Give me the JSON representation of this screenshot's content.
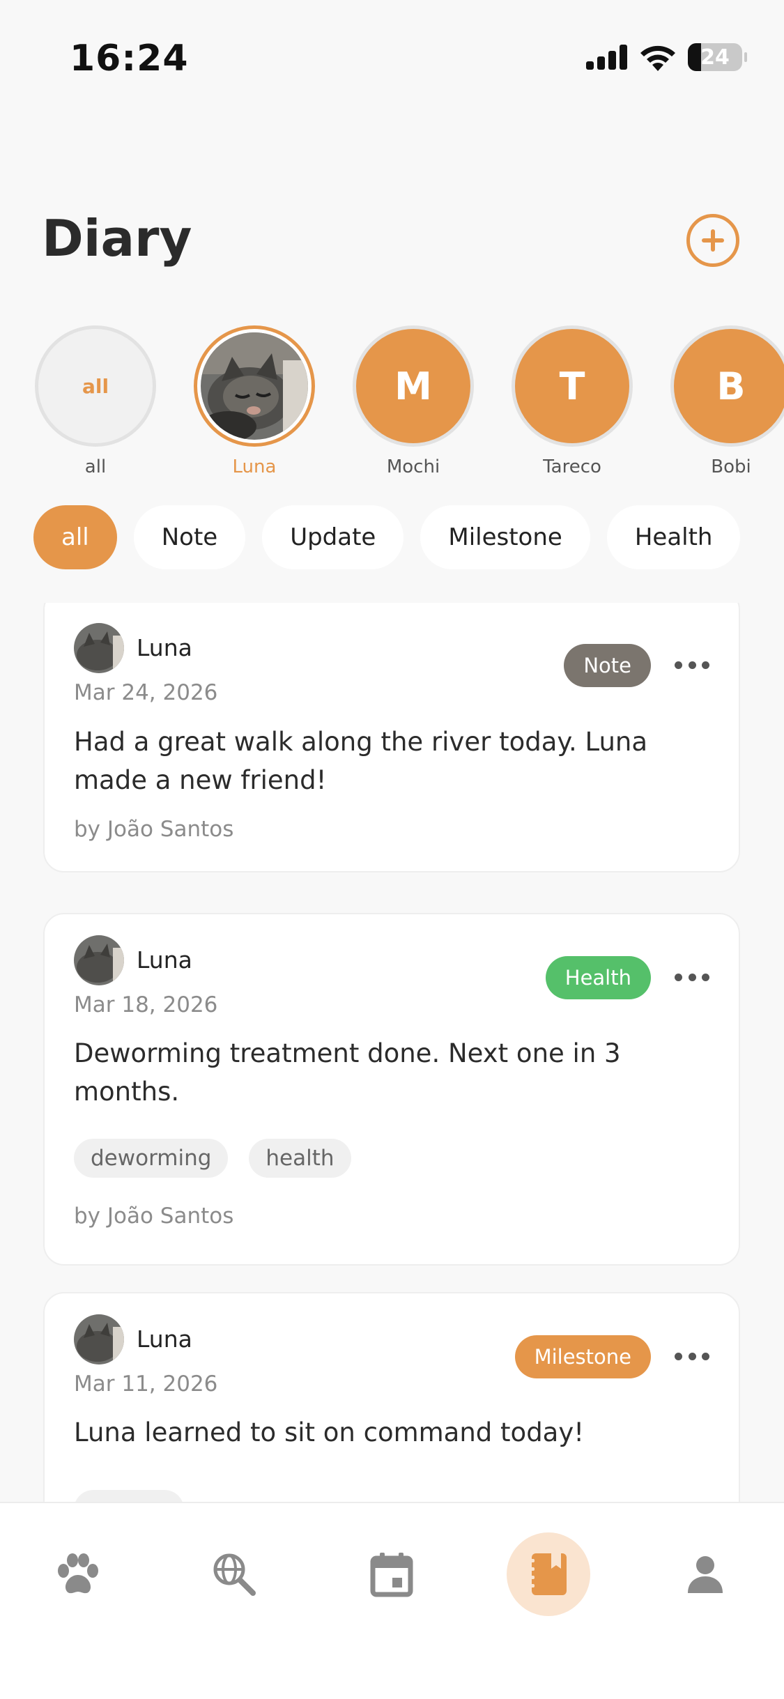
{
  "status": {
    "time": "16:24",
    "battery": "24",
    "battery_level": 0.24
  },
  "header": {
    "title": "Diary"
  },
  "pets": [
    {
      "label": "all",
      "name": "all",
      "type": "all"
    },
    {
      "name": "Luna",
      "type": "photo",
      "selected": true
    },
    {
      "label": "M",
      "name": "Mochi",
      "type": "letter"
    },
    {
      "label": "T",
      "name": "Tareco",
      "type": "letter"
    },
    {
      "label": "B",
      "name": "Bobi",
      "type": "letter"
    }
  ],
  "filters": [
    {
      "label": "all",
      "active": true
    },
    {
      "label": "Note"
    },
    {
      "label": "Update"
    },
    {
      "label": "Milestone"
    },
    {
      "label": "Health"
    }
  ],
  "entries": [
    {
      "pet": "Luna",
      "date": "Mar 24, 2026",
      "category": "Note",
      "category_color": "#7b756e",
      "text": "Had a great walk along the river today. Luna made a new friend!",
      "tags": [],
      "author": "by João Santos"
    },
    {
      "pet": "Luna",
      "date": "Mar 18, 2026",
      "category": "Health",
      "category_color": "#55c06a",
      "text": "Deworming treatment done. Next one in 3 months.",
      "tags": [
        "deworming",
        "health"
      ],
      "author": "by João Santos"
    },
    {
      "pet": "Luna",
      "date": "Mar 11, 2026",
      "category": "Milestone",
      "category_color": "#e5964a",
      "text": "Luna learned to sit on command today!",
      "tags": [],
      "author": ""
    }
  ],
  "nav": [
    {
      "icon": "paw-icon"
    },
    {
      "icon": "globe-search-icon"
    },
    {
      "icon": "calendar-icon"
    },
    {
      "icon": "diary-icon",
      "active": true
    },
    {
      "icon": "profile-icon"
    }
  ],
  "colors": {
    "accent": "#e5964a",
    "accent_light": "#fae4d0",
    "icon_gray": "#8a8a8a"
  }
}
